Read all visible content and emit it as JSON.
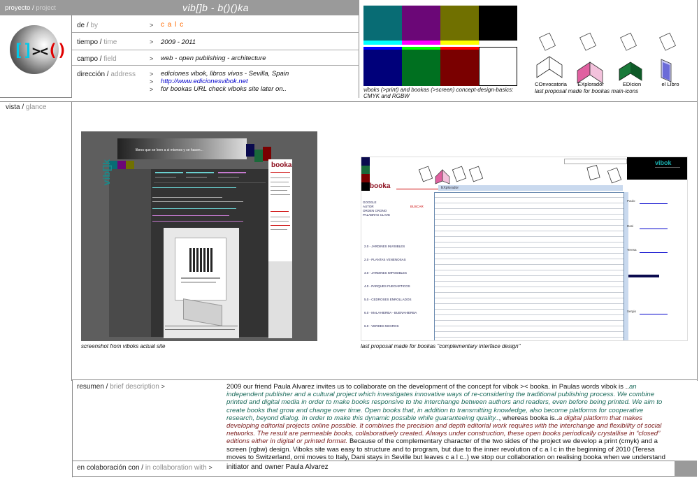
{
  "header": {
    "proyecto_es": "proyecto",
    "proyecto_en": "project",
    "title": "vib[]b - b()()ka",
    "logo_text": "[]><()"
  },
  "fields": [
    {
      "label_es": "de",
      "label_en": "by",
      "value": "c a l c"
    },
    {
      "label_es": "tiempo",
      "label_en": "time",
      "value": "2009 - 2011"
    },
    {
      "label_es": "campo",
      "label_en": "field",
      "value": "web - open publishing - architecture"
    }
  ],
  "address": {
    "label_es": "dirección",
    "label_en": "address",
    "line1": "ediciones vibok, libros vivos - Sevilla, Spain",
    "link": "http://www.edicionesvibok.net",
    "line3": "for bookas URL check viboks site later on.."
  },
  "color_panel": {
    "top_swatches": [
      "#086c74",
      "#6b0777",
      "#707000",
      "#000000"
    ],
    "strip_colors": [
      "#00ffff",
      "#ff00ff",
      "#ffff00",
      "#ffffff"
    ],
    "bottom_swatches": [
      "#00007a",
      "#007020",
      "#7a0000",
      "#ffffff"
    ],
    "caption": "viboks (>print) and bookas (>screen) concept-design-basics: CMYK and RGBW"
  },
  "icons": {
    "items": [
      {
        "label": "COnvocatoria",
        "icon": "book-outline-icon"
      },
      {
        "label": "EXplorador",
        "icon": "book-pink-icon"
      },
      {
        "label": "EDIcion",
        "icon": "book-green-icon"
      },
      {
        "label": "el LIbro",
        "icon": "book-blue-icon"
      }
    ],
    "caption": "last proposal made for bookas main-icons"
  },
  "vista": {
    "label_es": "vista",
    "label_en": "glance"
  },
  "screenshots": {
    "left_caption": "screenshot from viboks actual site",
    "right_caption": "last proposal made for bookas \"complementary interface design\"",
    "left_banner": "libros que se leen a si mismos y se hacen...",
    "left_brand": "booka",
    "right_brand": "booka",
    "right_brand2": "vibok",
    "right_header": "EXplorador",
    "right_search": "BUSCAR",
    "right_nav": [
      "GOOGLE",
      "AUTOR",
      "ORDEN CRONO",
      "PALABRAS CLAVE"
    ],
    "right_sections": [
      "2.0 - JARDINES INVISIBLES",
      "2.0 - PLANTAS VENENOSAS",
      "3.0 - JARDINES IMPOSIBLES",
      "4.0 - PARQUES FUEGARTICOS",
      "5.0 - CEDROSES ENROLLADOS",
      "6.0 - MALAHIERBA - BUENAHIERBA",
      "6.0 - VERDES NEGROS"
    ],
    "right_side": [
      "Paulo",
      "Dani",
      "Teresa",
      "Sergio"
    ]
  },
  "resumen": {
    "label_es": "resumen",
    "label_en": "brief description",
    "p1": "2009 our friend Paula Alvarez invites us to collaborate on the development of the concept for vibok >< booka. in Paulas words vibok is ..",
    "p2": "an independent publisher and a cultural project which investigates innovative ways of re-considering the traditional publishing process. We combine printed and digital media in order to make books responsive to the interchange between authors and readers, even before being printed. We aim to create books that grow and change over time. Open books that, in addition to transmitting knowledge, also become platforms for cooperative research, beyond dialog. In order to make this dynamic possible while guaranteeing quality..",
    "p3": ", whereas booka is..",
    "p4": "a digital platform that makes developing editorial projects online possible. It combines the precision and depth editorial work requires with the interchange and flexibility of social networks. The result are permeable books, collaboratively created. Always under construction, these open books periodically crystallise in “closed” editions either in digital or printed format.",
    "p5": " Because of the complementary character of the two sides of the project we develop a print (cmyk) and a screen (rgbw) design. Viboks site was easy to structure and to program, but due to the inner revolution of c a l c in the beginning of 2010 (Teresa moves to Switzerland, omi moves to Italy, Dani stays in Seville but leaves c a l c..) we stop our collaboration on realising booka when we understand that its better for Paula and the project that she realises it only with Dani - who's actually working on the complex program for this platform. To know more about the project and our collaboration please visit viboks site."
  },
  "collab": {
    "label_es": "en colaboración con",
    "label_en": "in collaboration with",
    "value": "initiator and owner Paula Alvarez"
  }
}
